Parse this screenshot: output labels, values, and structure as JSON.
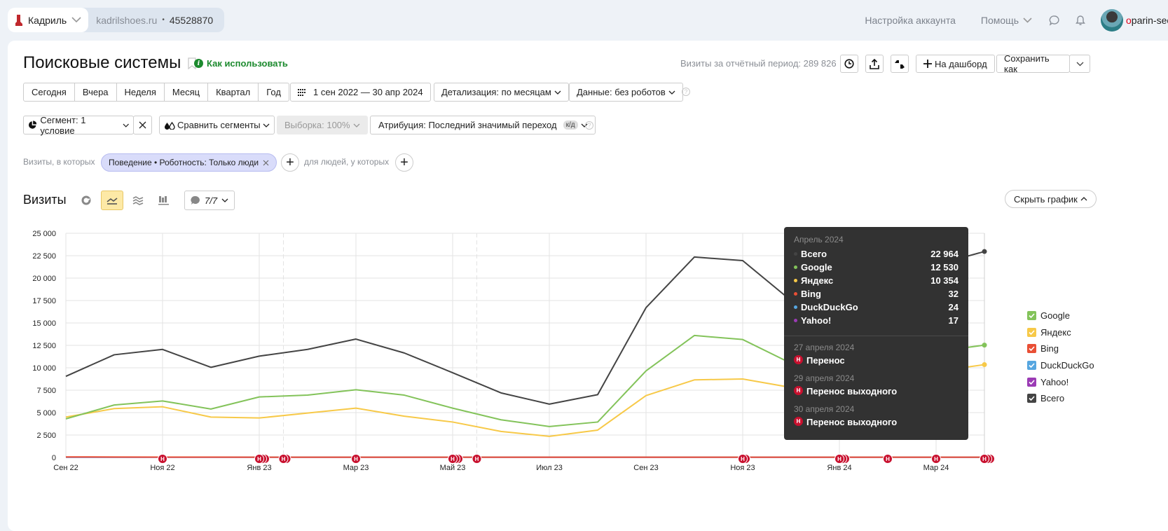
{
  "header": {
    "counter_name": "Кадриль",
    "counter_site": "kadrilshoes.ru",
    "counter_id": "45528870",
    "account_settings": "Настройка аккаунта",
    "help": "Помощь",
    "user_first_letter": "o",
    "user_rest": "parin-seo"
  },
  "report": {
    "title": "Поисковые системы",
    "how_to_use": "Как использовать",
    "visits_total": "Визиты за отчётный период: 289 826",
    "add_dashboard": "На дашборд",
    "save_as": "Сохранить как"
  },
  "periods": [
    "Сегодня",
    "Вчера",
    "Неделя",
    "Месяц",
    "Квартал",
    "Год"
  ],
  "date_range": "1 сен 2022 — 30 апр 2024",
  "detail": "Детализация: по месяцам",
  "data_filter": "Данные: без роботов",
  "segment": "Сегмент: 1 условие",
  "compare": "Сравнить сегменты",
  "sample": "Выборка: 100%",
  "attribution": "Атрибуция: Последний значимый переход",
  "attribution_badge": "к/д",
  "filters": {
    "visits_label": "Визиты, в которых",
    "chip": "Поведение • Роботность: Только люди",
    "people_label": "для людей, у которых"
  },
  "chart_header": {
    "title": "Визиты",
    "notes_count": "7/7",
    "hide_chart": "Скрыть график"
  },
  "chart_data": {
    "type": "line",
    "title": "Визиты",
    "xlabel": "",
    "ylabel": "",
    "ylim": [
      0,
      25000
    ],
    "y_ticks": [
      0,
      2500,
      5000,
      7500,
      10000,
      12500,
      15000,
      17500,
      20000,
      22500,
      25000
    ],
    "y_tick_labels": [
      "0",
      "2 500",
      "5 000",
      "7 500",
      "10 000",
      "12 500",
      "15 000",
      "17 500",
      "20 000",
      "22 500",
      "25 000"
    ],
    "x": [
      "2022-09",
      "2022-10",
      "2022-11",
      "2022-12",
      "2023-01",
      "2023-02",
      "2023-03",
      "2023-04",
      "2023-05",
      "2023-06",
      "2023-07",
      "2023-08",
      "2023-09",
      "2023-10",
      "2023-11",
      "2023-12",
      "2024-01",
      "2024-02",
      "2024-03",
      "2024-04"
    ],
    "x_tick_labels": [
      {
        "index": 0,
        "label": "Сен 22"
      },
      {
        "index": 2,
        "label": "Ноя 22"
      },
      {
        "index": 4,
        "label": "Янв 23"
      },
      {
        "index": 6,
        "label": "Мар 23"
      },
      {
        "index": 8,
        "label": "Май 23"
      },
      {
        "index": 10,
        "label": "Июл 23"
      },
      {
        "index": 12,
        "label": "Сен 23"
      },
      {
        "index": 14,
        "label": "Ноя 23"
      },
      {
        "index": 16,
        "label": "Янв 24"
      },
      {
        "index": 18,
        "label": "Мар 24"
      }
    ],
    "grid": true,
    "legend_position": "right",
    "series": [
      {
        "name": "Всего",
        "color": "#444444",
        "values": [
          9050,
          11450,
          12050,
          10050,
          11300,
          12050,
          13200,
          11650,
          9450,
          7200,
          5950,
          7000,
          16700,
          22350,
          21950,
          17500,
          18000,
          20500,
          21500,
          22964
        ]
      },
      {
        "name": "Google",
        "color": "#83c35a",
        "values": [
          4300,
          5850,
          6300,
          5400,
          6750,
          6950,
          7550,
          6950,
          5500,
          4200,
          3450,
          3950,
          9650,
          13600,
          13150,
          10500,
          10600,
          11300,
          11800,
          12530
        ]
      },
      {
        "name": "Яндекс",
        "color": "#f7c948",
        "values": [
          4500,
          5450,
          5650,
          4500,
          4400,
          4950,
          5500,
          4600,
          3950,
          2900,
          2350,
          3050,
          6900,
          8650,
          8750,
          7800,
          8200,
          8900,
          9600,
          10354
        ]
      },
      {
        "name": "Bing",
        "color": "#e94f35",
        "values": [
          60,
          50,
          40,
          35,
          30,
          30,
          30,
          30,
          30,
          30,
          30,
          30,
          30,
          30,
          30,
          30,
          30,
          30,
          30,
          32
        ]
      },
      {
        "name": "DuckDuckGo",
        "color": "#56a6e0",
        "values": [
          25,
          25,
          25,
          25,
          25,
          25,
          25,
          25,
          25,
          25,
          25,
          25,
          25,
          25,
          25,
          25,
          25,
          25,
          25,
          24
        ]
      },
      {
        "name": "Yahoo!",
        "color": "#9b3bb5",
        "values": [
          20,
          20,
          20,
          20,
          20,
          20,
          20,
          20,
          20,
          20,
          20,
          20,
          20,
          20,
          20,
          20,
          20,
          20,
          20,
          17
        ]
      }
    ],
    "holiday_markers": [
      {
        "index": 2,
        "count": 1
      },
      {
        "index": 4,
        "count": 3
      },
      {
        "index": 5,
        "count": 2
      },
      {
        "index": 6,
        "count": 1
      },
      {
        "index": 8,
        "count": 3
      },
      {
        "index": 9,
        "count": 1
      },
      {
        "index": 14,
        "count": 2
      },
      {
        "index": 16,
        "count": 3
      },
      {
        "index": 17,
        "count": 1
      },
      {
        "index": 18,
        "count": 1
      },
      {
        "index": 19,
        "count": 3
      }
    ],
    "marker_label": "Н"
  },
  "legend": [
    {
      "name": "Google",
      "color": "#83c35a"
    },
    {
      "name": "Яндекс",
      "color": "#f7c948"
    },
    {
      "name": "Bing",
      "color": "#e94f35"
    },
    {
      "name": "DuckDuckGo",
      "color": "#56a6e0"
    },
    {
      "name": "Yahoo!",
      "color": "#9b3bb5"
    },
    {
      "name": "Всего",
      "color": "#444444"
    }
  ],
  "tooltip": {
    "month": "Апрель 2024",
    "rows": [
      {
        "name": "Всего",
        "value": "22 964",
        "color": "#444444"
      },
      {
        "name": "Google",
        "value": "12 530",
        "color": "#83c35a"
      },
      {
        "name": "Яндекс",
        "value": "10 354",
        "color": "#f7c948"
      },
      {
        "name": "Bing",
        "value": "32",
        "color": "#e94f35"
      },
      {
        "name": "DuckDuckGo",
        "value": "24",
        "color": "#56a6e0"
      },
      {
        "name": "Yahoo!",
        "value": "17",
        "color": "#9b3bb5"
      }
    ],
    "notes": [
      {
        "date": "27 апреля 2024",
        "title": "Перенос"
      },
      {
        "date": "29 апреля 2024",
        "title": "Перенос выходного"
      },
      {
        "date": "30 апреля 2024",
        "title": "Перенос выходного"
      }
    ]
  }
}
